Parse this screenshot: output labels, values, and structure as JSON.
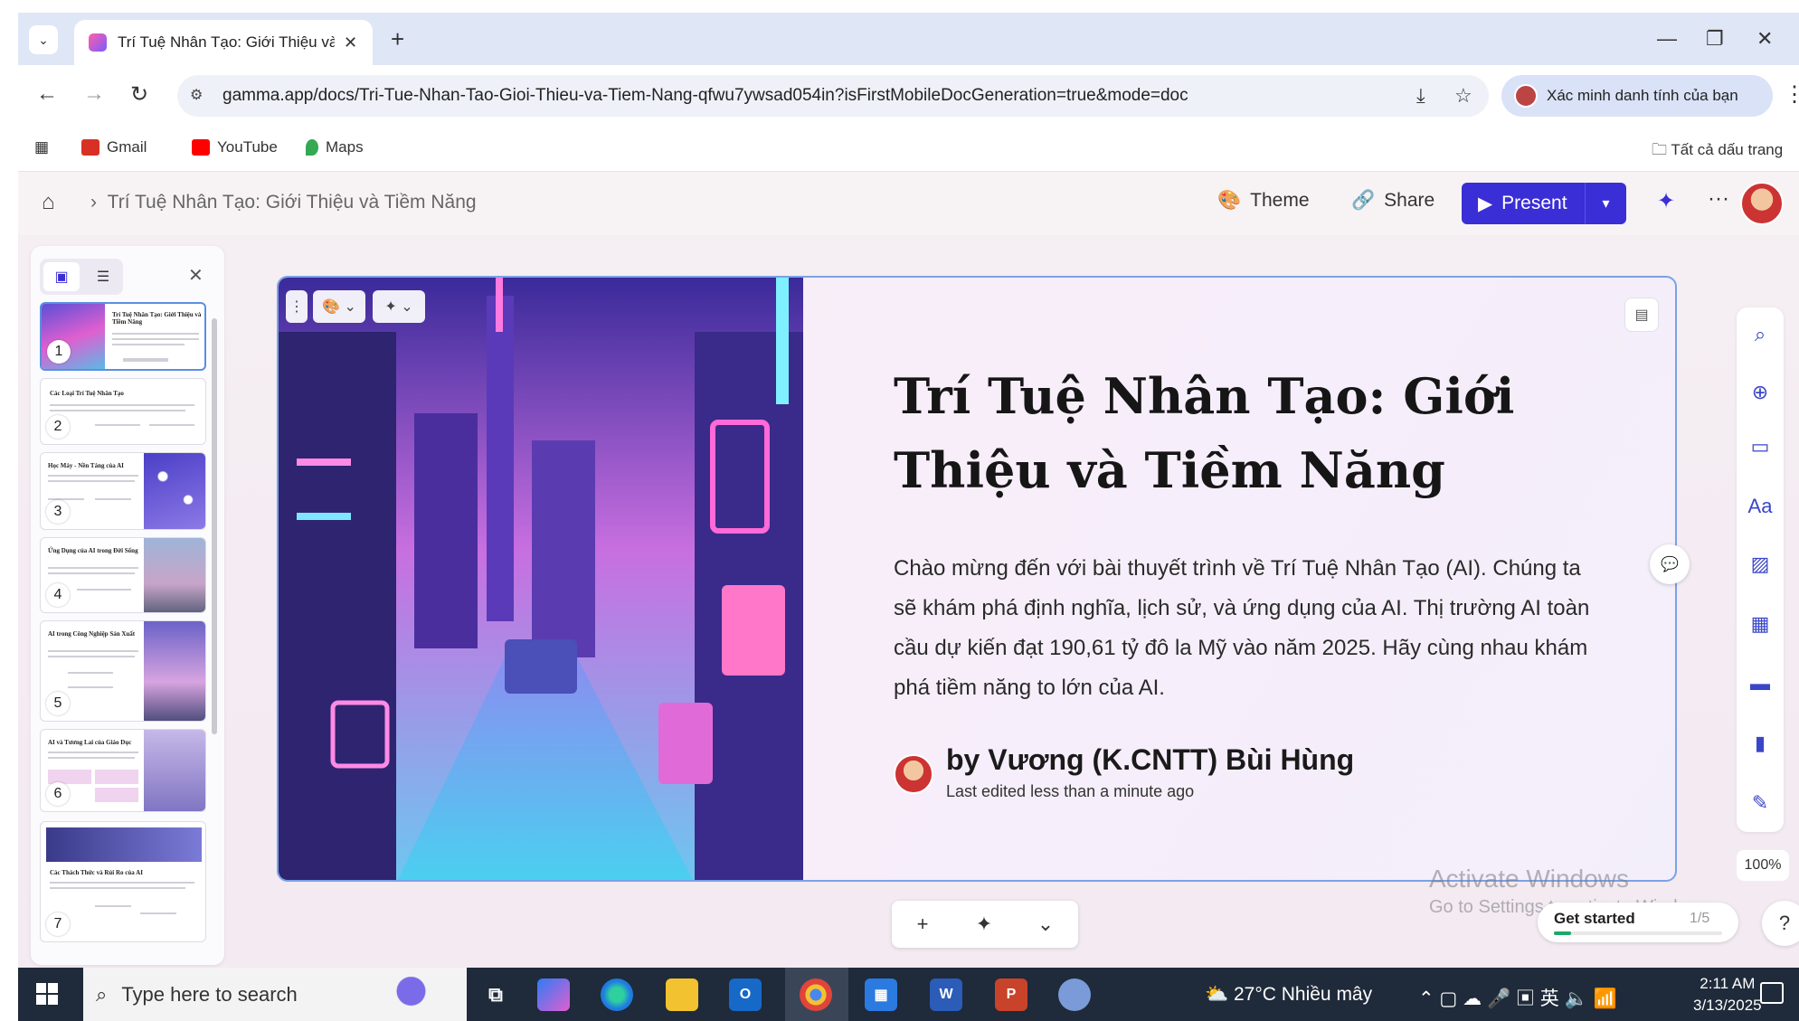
{
  "browser": {
    "tab": {
      "title": "Trí Tuệ Nhân Tạo: Giới Thiệu và",
      "close": "✕"
    },
    "new_tab": "+",
    "window": {
      "minimize": "—",
      "restore": "❐",
      "close": "✕"
    },
    "url": "gamma.app/docs/Tri-Tue-Nhan-Tao-Gioi-Thieu-va-Tiem-Nang-qfwu7ywsad054in?isFirstMobileDocGeneration=true&mode=doc",
    "verify_label": "Xác minh danh tính của bạn",
    "bookmarks": [
      {
        "label": "Gmail",
        "color": "#d93025"
      },
      {
        "label": "YouTube",
        "color": "#ff0000"
      },
      {
        "label": "Maps",
        "color": "#34a853"
      }
    ],
    "all_bookmarks": "Tất cả dấu trang"
  },
  "gamma": {
    "breadcrumb": "Trí Tuệ Nhân Tạo: Giới Thiệu và Tiềm Năng",
    "theme_label": "Theme",
    "share_label": "Share",
    "present_label": "Present",
    "accent": "#3a2ed6"
  },
  "sidebar": {
    "slides": [
      {
        "num": "1",
        "title": "Trí Tuệ Nhân Tạo: Giới Thiệu và Tiềm Năng"
      },
      {
        "num": "2",
        "title": "Các Loại Trí Tuệ Nhân Tạo"
      },
      {
        "num": "3",
        "title": "Học Máy - Nền Tảng của AI"
      },
      {
        "num": "4",
        "title": "Ứng Dụng của AI trong Đời Sống"
      },
      {
        "num": "5",
        "title": "AI trong Công Nghiệp Sản Xuất"
      },
      {
        "num": "6",
        "title": "AI và Tương Lai của Giáo Dục"
      },
      {
        "num": "7",
        "title": "Các Thách Thức và Rủi Ro của AI"
      }
    ]
  },
  "card": {
    "title": "Trí Tuệ Nhân Tạo: Giới Thiệu và Tiềm Năng",
    "body": "Chào mừng đến với bài thuyết trình về Trí Tuệ Nhân Tạo (AI). Chúng ta sẽ khám phá định nghĩa, lịch sử, và ứng dụng của AI. Thị trường AI toàn cầu dự kiến đạt 190,61 tỷ đô la Mỹ vào năm 2025. Hãy cùng nhau khám phá tiềm năng to lớn của AI.",
    "author": "by Vương (K.CNTT) Bùi Hùng",
    "edited": "Last edited less than a minute ago"
  },
  "zoom": "100%",
  "help": "?",
  "get_started": {
    "label": "Get started",
    "count": "1/5",
    "progress": 0.1
  },
  "watermark": {
    "line1": "Activate Windows",
    "line2": "Go to Settings to activate Windows."
  },
  "taskbar": {
    "search_placeholder": "Type here to search",
    "weather": "27°C  Nhiều mây",
    "time": "2:11 AM",
    "date": "3/13/2025"
  }
}
